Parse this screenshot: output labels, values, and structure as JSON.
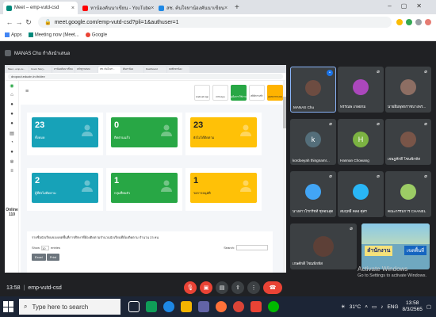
{
  "browser": {
    "tabs": [
      {
        "label": "Meet – emp-vutd-csd",
        "active": true,
        "color": "#00897b"
      },
      {
        "label": "หาน้องคันนาเขียน - YouTube",
        "active": false,
        "color": "#ff0000"
      },
      {
        "label": "สช. ค้นใจหาน้องคันนาเขียน",
        "active": false,
        "color": "#1e88e5"
      }
    ],
    "url": "meet.google.com/emp-vutd-csd?pli=1&authuser=1",
    "bookmarks": [
      "Apps",
      "Meeting now (Meet...",
      "Google"
    ]
  },
  "meet": {
    "presenter_label": "MANAS Chu กำลังนำเสนอ",
    "shared_screen": {
      "tabs": [
        "Meet - emp-vu...",
        "Cover Story...",
        "หาน้องคันนาเขียน",
        "หลักฐานสอบ",
        "สช. ค้นใจหา...",
        "ค้นหาน้อง",
        "Dashboard",
        "หอพักหาน้อง"
      ],
      "url": "dropout.eduzin.in.th/dev",
      "online_label": "Online",
      "online_count": "110",
      "top_buttons": [
        "Android App",
        "iOS App",
        "คู่มือการใช้งาน",
        "สถิติการเข้า",
        "ออกจากระบบ"
      ],
      "cards": [
        {
          "num": "23",
          "label": "ทั้งหมด",
          "color": "blue"
        },
        {
          "num": "0",
          "label": "ติดตามแล้ว",
          "color": "green"
        },
        {
          "num": "23",
          "label": "ยังไม่ได้ติดตาม",
          "color": "yellow"
        },
        {
          "num": "2",
          "label": "ผู้ที่ยังไม่ติดตาม",
          "color": "blue"
        },
        {
          "num": "1",
          "label": "กลุ่มที่พบตัว",
          "color": "green"
        },
        {
          "num": "1",
          "label": "รอการอนุมัติ",
          "color": "yellow"
        }
      ],
      "table_title": "รายชื่อนักเรียนของเขตพื้นที่การศึกษาที่ต้องติดตามจำนวนนักเรียนที่ต้องติดตาม จำนวน 23 คน",
      "show_label": "Show",
      "entries_value": "10",
      "entries_label": "entries",
      "search_label": "Search:",
      "buttons": [
        "Excel",
        "Print"
      ]
    },
    "participants": [
      {
        "name": "MANAS Chu",
        "avatar_color": "#6d4c41",
        "initial": "",
        "speaking": true
      },
      {
        "name": "พรรณพ เกษยกม",
        "avatar_color": "#ab47bc",
        "initial": "",
        "speaking": false
      },
      {
        "name": "นายยิ้มพุทธราชบางพร...",
        "avatar_color": "#8d6e63",
        "initial": "",
        "speaking": false
      },
      {
        "name": "kordoeyah thingnamr...",
        "avatar_color": "#546e7a",
        "initial": "k",
        "speaking": false
      },
      {
        "name": "Hannan Chowang",
        "avatar_color": "#7cb342",
        "initial": "H",
        "speaking": false
      },
      {
        "name": "เจษฎศักดิ์ โซนฟักทัส",
        "avatar_color": "#795548",
        "initial": "",
        "speaking": false
      },
      {
        "name": "นางสาวโรกรัชท์ ชุทอนสุด",
        "avatar_color": "#42a5f5",
        "initial": "",
        "speaking": false
      },
      {
        "name": "สมฤทธิ์ คลอ ศุสร",
        "avatar_color": "#29b6f6",
        "initial": "",
        "speaking": false
      },
      {
        "name": "คณะกรรมการ CHANEL",
        "avatar_color": "#9ccc65",
        "initial": "",
        "speaking": false
      },
      {
        "name": "เกษศักดิ์ โซนฟักทัส",
        "avatar_color": "#5d4037",
        "initial": "",
        "speaking": false
      }
    ],
    "banner": {
      "title": "ลำนักงาน",
      "subtitle": "เขตพื้นที่"
    },
    "time": "13:58",
    "meeting_code": "emp-vutd-csd"
  },
  "windows_activation": {
    "line1": "Activate Windows",
    "line2": "Go to Settings to activate Windows."
  },
  "taskbar": {
    "search_placeholder": "Type here to search",
    "weather": "31°C",
    "language": "ENG",
    "time": "13:58",
    "date": "8/3/2565"
  }
}
